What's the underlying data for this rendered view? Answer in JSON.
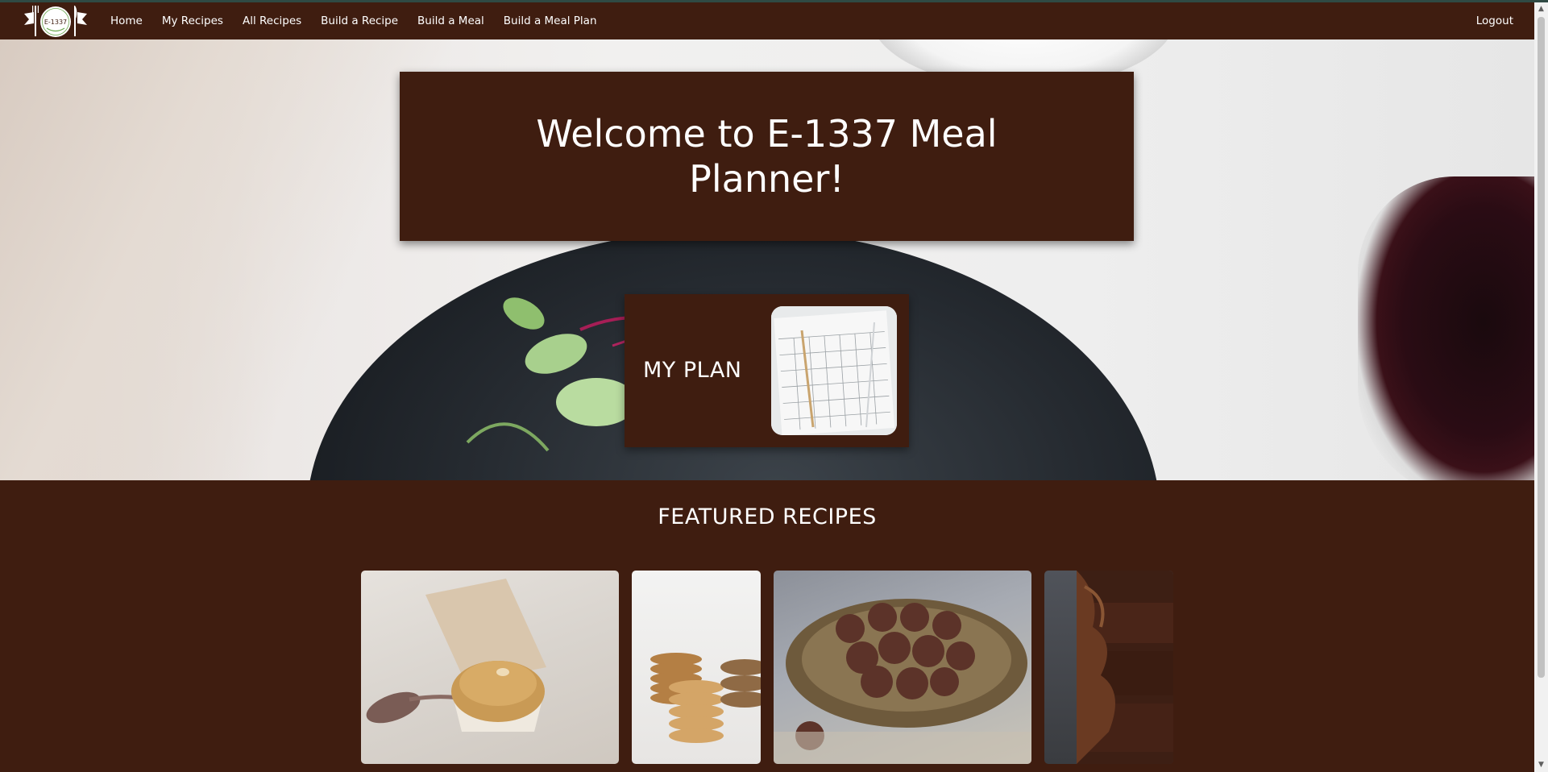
{
  "nav": {
    "logo_text": "E-1337",
    "links": [
      "Home",
      "My Recipes",
      "All Recipes",
      "Build a Recipe",
      "Build a Meal",
      "Build a Meal Plan"
    ],
    "logout": "Logout"
  },
  "hero": {
    "welcome": "Welcome to E-1337 Meal Planner!",
    "plan_label": "MY PLAN"
  },
  "featured": {
    "title": "FEATURED RECIPES"
  },
  "colors": {
    "brand_brown": "#3f1d10",
    "text": "#ffffff"
  }
}
